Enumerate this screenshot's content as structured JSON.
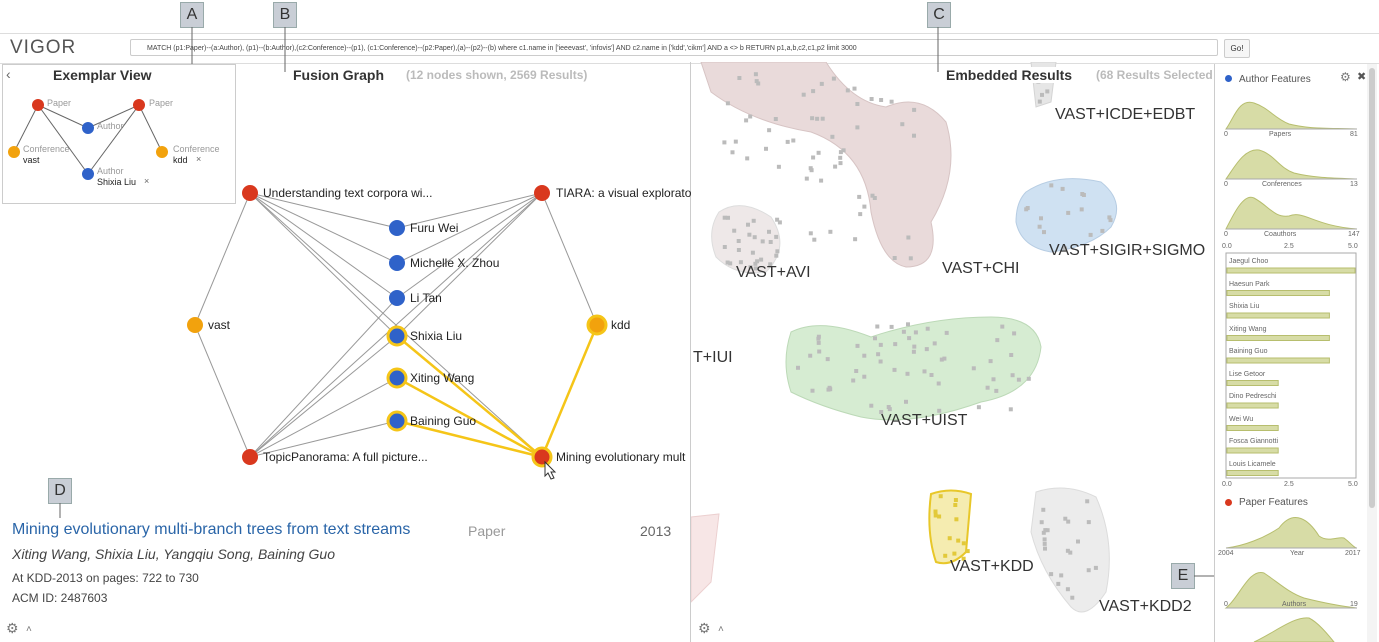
{
  "app": {
    "name": "VIGOR"
  },
  "query": {
    "text": "MATCH (p1:Paper)--(a:Author), (p1)--(b:Author),(c2:Conference)--(p1), (c1:Conference)--(p2:Paper),(a)--(p2)--(b)  where c1.name in ['ieeevast', 'infovis'] AND c2.name in ['kdd','cikm'] AND a <> b  RETURN p1,a,b,c2,c1,p2 limit 3000",
    "go_label": "Go!"
  },
  "callouts": {
    "a": "A",
    "b": "B",
    "c": "C",
    "d": "D",
    "e": "E"
  },
  "exemplar": {
    "back": "‹",
    "title": "Exemplar View",
    "nodes": [
      {
        "type": "Paper",
        "value": ""
      },
      {
        "type": "Paper",
        "value": ""
      },
      {
        "type": "Author",
        "value": ""
      },
      {
        "type": "Conference",
        "value": "vast"
      },
      {
        "type": "Conference",
        "value": "kdd"
      },
      {
        "type": "Author",
        "value": "Shixia Liu"
      }
    ],
    "remove": "×"
  },
  "fusion": {
    "title": "Fusion Graph",
    "subtitle": "(12 nodes shown, 2569 Results)",
    "nodes": [
      {
        "label": "Understanding text corpora wi..."
      },
      {
        "label": "TIARA: a visual explorato"
      },
      {
        "label": "Furu Wei"
      },
      {
        "label": "Michelle X. Zhou"
      },
      {
        "label": "Li Tan"
      },
      {
        "label": "Shixia Liu"
      },
      {
        "label": "vast"
      },
      {
        "label": "kdd"
      },
      {
        "label": "Xiting Wang"
      },
      {
        "label": "Baining Guo"
      },
      {
        "label": "TopicPanorama: A full picture..."
      },
      {
        "label": "Mining evolutionary mult"
      }
    ]
  },
  "detail": {
    "title": "Mining evolutionary multi-branch trees from text streams",
    "type": "Paper",
    "year": "2013",
    "authors": "Xiting Wang, Shixia Liu, Yangqiu Song, Baining Guo",
    "venue": "At KDD-2013 on pages: 722 to 730",
    "acm": "ACM ID: 2487603"
  },
  "embedded": {
    "title": "Embedded Results",
    "subtitle": "(68 Results Selected",
    "clusters": [
      {
        "label": "VAST+ICDE+EDBT"
      },
      {
        "label": "VAST+AVI"
      },
      {
        "label": "VAST+CHI"
      },
      {
        "label": "VAST+SIGIR+SIGMO"
      },
      {
        "label": "T+IUI"
      },
      {
        "label": "VAST+UIST"
      },
      {
        "label": "VAST+KDD"
      },
      {
        "label": "VAST+KDD2"
      }
    ]
  },
  "features": {
    "author_title": "Author Features",
    "paper_title": "Paper Features",
    "gear": "⚙",
    "close": "✖",
    "dist": [
      {
        "label": "Papers",
        "min": "0",
        "max": "81"
      },
      {
        "label": "Conferences",
        "min": "0",
        "max": "13"
      },
      {
        "label": "Coauthors",
        "min": "0",
        "max": "147"
      }
    ],
    "bar_axis": [
      "0.0",
      "2.5",
      "5.0"
    ],
    "bars": [
      {
        "name": "Jaegul Choo",
        "value": 5.0
      },
      {
        "name": "Haesun Park",
        "value": 4.0
      },
      {
        "name": "Shixia Liu",
        "value": 4.0
      },
      {
        "name": "Xiting Wang",
        "value": 4.0
      },
      {
        "name": "Baining Guo",
        "value": 4.0
      },
      {
        "name": "Lise Getoor",
        "value": 2.0
      },
      {
        "name": "Dino Pedreschi",
        "value": 2.0
      },
      {
        "name": "Wei Wu",
        "value": 2.0
      },
      {
        "name": "Fosca Giannotti",
        "value": 2.0
      },
      {
        "name": "Louis Licamele",
        "value": 2.0
      }
    ],
    "year": {
      "label": "Year",
      "min": "2004",
      "max": "2017"
    },
    "authors": {
      "label": "Authors",
      "min": "0",
      "max": "19"
    }
  },
  "colors": {
    "paper": "#d9381e",
    "author": "#2f62c9",
    "conference": "#f2a20d",
    "highlight": "#f5c518"
  }
}
